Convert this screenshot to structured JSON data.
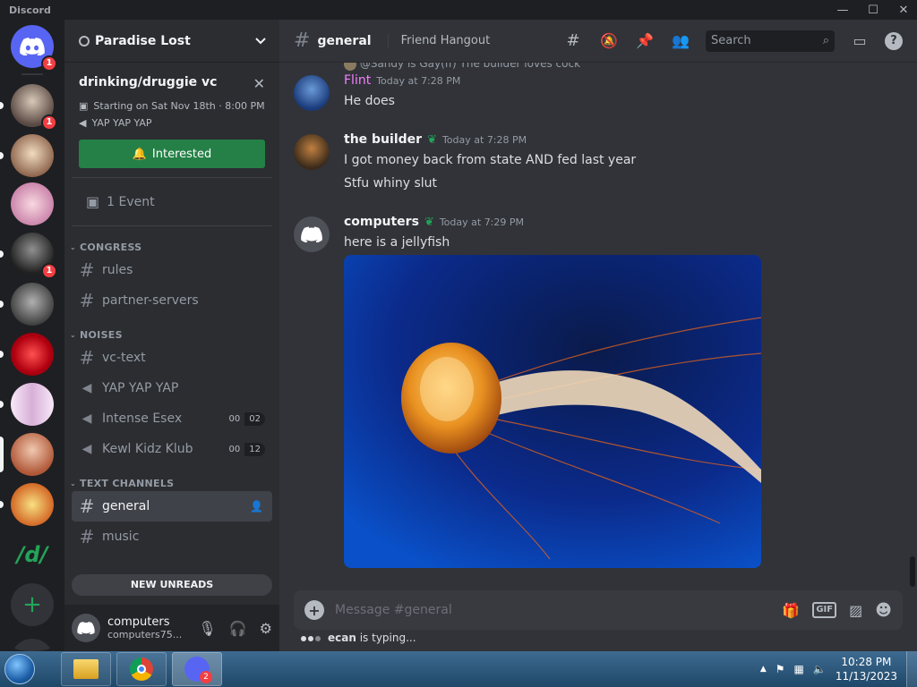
{
  "window": {
    "app_name": "Discord",
    "minimize": "—",
    "maximize": "☐",
    "close": "✕"
  },
  "servers": [
    {
      "name": "Direct Messages",
      "badge": "1",
      "color": "#5865f2"
    },
    {
      "name": "Server 1",
      "badge": "1",
      "color": "#8a7a70"
    },
    {
      "name": "Server 2",
      "badge": "",
      "color": "#c8a888"
    },
    {
      "name": "Server 3",
      "badge": "",
      "color": "#e8b8c8"
    },
    {
      "name": "Server 4",
      "badge": "1",
      "color": "#444444"
    },
    {
      "name": "Server 5",
      "badge": "",
      "color": "#6a6a6a"
    },
    {
      "name": "Server 6",
      "badge": "",
      "color": "#d0202a"
    },
    {
      "name": "Server 7",
      "badge": "",
      "color": "#e8d0e8"
    },
    {
      "name": "Server 8",
      "badge": "",
      "color": "#c06040"
    },
    {
      "name": "Server 9",
      "badge": "",
      "color": "#d8a040"
    },
    {
      "name": "/d/",
      "badge": "",
      "color": "#1e1f22"
    }
  ],
  "guild": {
    "name": "Paradise Lost",
    "event": {
      "title": "drinking/druggie vc",
      "time": "Starting on Sat Nov 18th · 8:00 PM",
      "location": "YAP YAP YAP",
      "button": "Interested"
    },
    "events_label": "1 Event",
    "categories": [
      {
        "name": "CONGRESS",
        "channels": [
          {
            "name": "rules",
            "type": "text"
          },
          {
            "name": "partner-servers",
            "type": "text"
          }
        ]
      },
      {
        "name": "NOISES",
        "channels": [
          {
            "name": "vc-text",
            "type": "text"
          },
          {
            "name": "YAP YAP YAP",
            "type": "voice"
          },
          {
            "name": "Intense Esex",
            "type": "voice",
            "count_a": "00",
            "count_b": "02"
          },
          {
            "name": "Kewl Kidz Klub",
            "type": "voice",
            "count_a": "00",
            "count_b": "12"
          }
        ]
      },
      {
        "name": "TEXT CHANNELS",
        "channels": [
          {
            "name": "general",
            "type": "text"
          },
          {
            "name": "music",
            "type": "text"
          }
        ]
      }
    ],
    "new_unreads": "NEW UNREADS"
  },
  "user": {
    "name": "computers",
    "tag": "computers75..."
  },
  "channel": {
    "name": "general",
    "topic": "Friend Hangout",
    "search_placeholder": "Search",
    "composer_placeholder": "Message #general"
  },
  "messages": [
    {
      "reply": "@Sandy is Gay(ff) The builder loves cock",
      "author": "Flint",
      "author_color": "#f47fff",
      "time": "Today at 7:28 PM",
      "lines": [
        "He does"
      ]
    },
    {
      "author": "the builder",
      "author_color": "#f2f3f5",
      "time": "Today at 7:28 PM",
      "lines": [
        "I got money back from state AND fed last year",
        "Stfu whiny slut"
      ]
    },
    {
      "author": "computers",
      "author_color": "#f2f3f5",
      "time": "Today at 7:29 PM",
      "lines": [
        "here is a jellyfish"
      ]
    }
  ],
  "typing": {
    "user": "ecan",
    "text": " is typing..."
  },
  "taskbar": {
    "time": "10:28 PM",
    "date": "11/13/2023",
    "discord_badge": "2"
  }
}
